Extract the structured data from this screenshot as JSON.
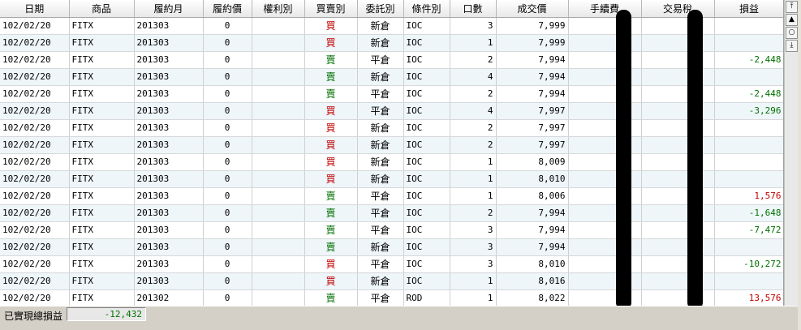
{
  "columns": [
    "日期",
    "商品",
    "履約月",
    "履約價",
    "權利別",
    "買賣別",
    "委託別",
    "條件別",
    "口數",
    "成交價",
    "手續費",
    "交易稅",
    "損益"
  ],
  "rows": [
    {
      "date": "102/02/20",
      "product": "FITX",
      "month": "201303",
      "strike": "0",
      "right": "",
      "side": "買",
      "side_type": "buy",
      "order": "新倉",
      "cond": "IOC",
      "qty": "3",
      "price": "7,999",
      "fee": "",
      "tax": "",
      "pnl": "",
      "pnl_type": ""
    },
    {
      "date": "102/02/20",
      "product": "FITX",
      "month": "201303",
      "strike": "0",
      "right": "",
      "side": "買",
      "side_type": "buy",
      "order": "新倉",
      "cond": "IOC",
      "qty": "1",
      "price": "7,999",
      "fee": "",
      "tax": "",
      "pnl": "",
      "pnl_type": ""
    },
    {
      "date": "102/02/20",
      "product": "FITX",
      "month": "201303",
      "strike": "0",
      "right": "",
      "side": "賣",
      "side_type": "sell",
      "order": "平倉",
      "cond": "IOC",
      "qty": "2",
      "price": "7,994",
      "fee": "",
      "tax": "",
      "pnl": "-2,448",
      "pnl_type": "neg"
    },
    {
      "date": "102/02/20",
      "product": "FITX",
      "month": "201303",
      "strike": "0",
      "right": "",
      "side": "賣",
      "side_type": "sell",
      "order": "新倉",
      "cond": "IOC",
      "qty": "4",
      "price": "7,994",
      "fee": "",
      "tax": "",
      "pnl": "",
      "pnl_type": ""
    },
    {
      "date": "102/02/20",
      "product": "FITX",
      "month": "201303",
      "strike": "0",
      "right": "",
      "side": "賣",
      "side_type": "sell",
      "order": "平倉",
      "cond": "IOC",
      "qty": "2",
      "price": "7,994",
      "fee": "",
      "tax": "",
      "pnl": "-2,448",
      "pnl_type": "neg"
    },
    {
      "date": "102/02/20",
      "product": "FITX",
      "month": "201303",
      "strike": "0",
      "right": "",
      "side": "買",
      "side_type": "buy",
      "order": "平倉",
      "cond": "IOC",
      "qty": "4",
      "price": "7,997",
      "fee": "",
      "tax": "",
      "pnl": "-3,296",
      "pnl_type": "neg"
    },
    {
      "date": "102/02/20",
      "product": "FITX",
      "month": "201303",
      "strike": "0",
      "right": "",
      "side": "買",
      "side_type": "buy",
      "order": "新倉",
      "cond": "IOC",
      "qty": "2",
      "price": "7,997",
      "fee": "",
      "tax": "",
      "pnl": "",
      "pnl_type": ""
    },
    {
      "date": "102/02/20",
      "product": "FITX",
      "month": "201303",
      "strike": "0",
      "right": "",
      "side": "買",
      "side_type": "buy",
      "order": "新倉",
      "cond": "IOC",
      "qty": "2",
      "price": "7,997",
      "fee": "",
      "tax": "",
      "pnl": "",
      "pnl_type": ""
    },
    {
      "date": "102/02/20",
      "product": "FITX",
      "month": "201303",
      "strike": "0",
      "right": "",
      "side": "買",
      "side_type": "buy",
      "order": "新倉",
      "cond": "IOC",
      "qty": "1",
      "price": "8,009",
      "fee": "",
      "tax": "",
      "pnl": "",
      "pnl_type": ""
    },
    {
      "date": "102/02/20",
      "product": "FITX",
      "month": "201303",
      "strike": "0",
      "right": "",
      "side": "買",
      "side_type": "buy",
      "order": "新倉",
      "cond": "IOC",
      "qty": "1",
      "price": "8,010",
      "fee": "",
      "tax": "",
      "pnl": "",
      "pnl_type": ""
    },
    {
      "date": "102/02/20",
      "product": "FITX",
      "month": "201303",
      "strike": "0",
      "right": "",
      "side": "賣",
      "side_type": "sell",
      "order": "平倉",
      "cond": "IOC",
      "qty": "1",
      "price": "8,006",
      "fee": "",
      "tax": "",
      "pnl": "1,576",
      "pnl_type": "pos"
    },
    {
      "date": "102/02/20",
      "product": "FITX",
      "month": "201303",
      "strike": "0",
      "right": "",
      "side": "賣",
      "side_type": "sell",
      "order": "平倉",
      "cond": "IOC",
      "qty": "2",
      "price": "7,994",
      "fee": "",
      "tax": "",
      "pnl": "-1,648",
      "pnl_type": "neg"
    },
    {
      "date": "102/02/20",
      "product": "FITX",
      "month": "201303",
      "strike": "0",
      "right": "",
      "side": "賣",
      "side_type": "sell",
      "order": "平倉",
      "cond": "IOC",
      "qty": "3",
      "price": "7,994",
      "fee": "",
      "tax": "",
      "pnl": "-7,472",
      "pnl_type": "neg"
    },
    {
      "date": "102/02/20",
      "product": "FITX",
      "month": "201303",
      "strike": "0",
      "right": "",
      "side": "賣",
      "side_type": "sell",
      "order": "新倉",
      "cond": "IOC",
      "qty": "3",
      "price": "7,994",
      "fee": "",
      "tax": "",
      "pnl": "",
      "pnl_type": ""
    },
    {
      "date": "102/02/20",
      "product": "FITX",
      "month": "201303",
      "strike": "0",
      "right": "",
      "side": "買",
      "side_type": "buy",
      "order": "平倉",
      "cond": "IOC",
      "qty": "3",
      "price": "8,010",
      "fee": "",
      "tax": "",
      "pnl": "-10,272",
      "pnl_type": "neg"
    },
    {
      "date": "102/02/20",
      "product": "FITX",
      "month": "201303",
      "strike": "0",
      "right": "",
      "side": "買",
      "side_type": "buy",
      "order": "新倉",
      "cond": "IOC",
      "qty": "1",
      "price": "8,016",
      "fee": "",
      "tax": "",
      "pnl": "",
      "pnl_type": ""
    },
    {
      "date": "102/02/20",
      "product": "FITX",
      "month": "201302",
      "strike": "0",
      "right": "",
      "side": "賣",
      "side_type": "sell",
      "order": "平倉",
      "cond": "ROD",
      "qty": "1",
      "price": "8,022",
      "fee": "",
      "tax": "",
      "pnl": "13,576",
      "pnl_type": "pos"
    }
  ],
  "footer": {
    "label": "已實現總損益",
    "value": "-12,432"
  },
  "scrollbar": {
    "top_icon": "scroll-top-icon",
    "up_icon": "scroll-up-icon",
    "center_icon": "scroll-center-icon",
    "bottom_icon": "scroll-bottom-icon"
  },
  "colors": {
    "buy": "#c00000",
    "sell": "#007000",
    "profit": "#c00000",
    "loss": "#007000",
    "row_alt": "#eef6fa"
  }
}
